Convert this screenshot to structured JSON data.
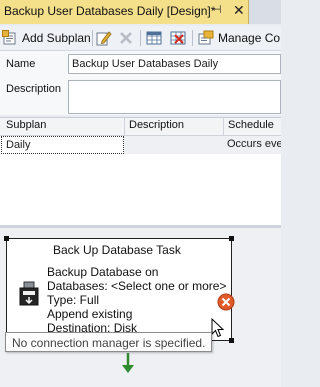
{
  "document_tab": {
    "title": "Backup User Databases Daily [Design]*",
    "pin_glyph": "⊣",
    "close_glyph": "✕"
  },
  "toolbar": {
    "add_subplan_label": "Add Subplan",
    "manage_connections_label": "Manage Co"
  },
  "properties": {
    "name_label": "Name",
    "name_value": "Backup User Databases Daily",
    "description_label": "Description",
    "description_value": ""
  },
  "subplan_grid": {
    "columns": [
      "Subplan",
      "Description",
      "Schedule"
    ],
    "rows": [
      {
        "subplan": "Daily",
        "description": "",
        "schedule": "Occurs eve"
      }
    ]
  },
  "designer": {
    "task": {
      "title": "Back Up Database Task",
      "lines": [
        "Backup Database on",
        "Databases: <Select one or more>",
        "Type: Full",
        "Append existing",
        "Destination: Disk"
      ]
    },
    "tooltip": "No connection manager is specified."
  },
  "colors": {
    "tab_active": "#f4df8a",
    "error": "#e05a2a",
    "arrow": "#2e8b2e"
  }
}
